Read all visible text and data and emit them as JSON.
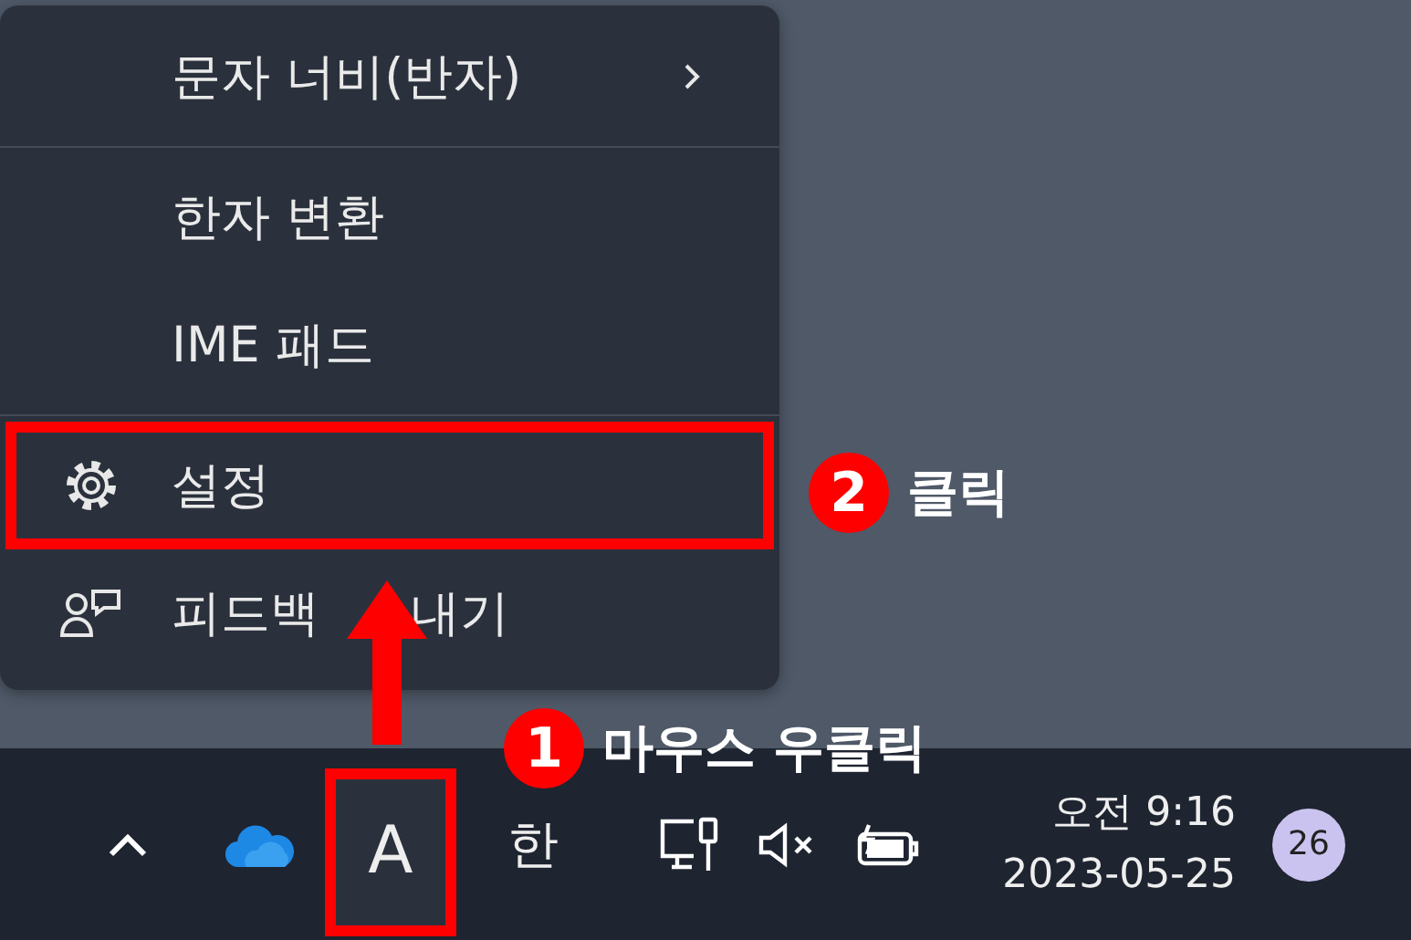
{
  "menu": {
    "items": [
      {
        "kind": "submenu",
        "label": "문자 너비(반자)",
        "highlighted": false,
        "separator_after": true
      },
      {
        "kind": "plain",
        "label": "한자 변환",
        "highlighted": false,
        "separator_after": false
      },
      {
        "kind": "plain",
        "label": "IME 패드",
        "highlighted": false,
        "separator_after": true
      },
      {
        "kind": "settings",
        "label": "설정",
        "highlighted": true,
        "separator_after": false
      },
      {
        "kind": "feedback",
        "label": "피드백",
        "label_tail": "내기",
        "highlighted": false,
        "separator_after": false
      }
    ]
  },
  "taskbar": {
    "input_mode": {
      "label": "A",
      "highlighted": true
    },
    "language": "한",
    "clock": {
      "time": "오전 9:16",
      "date": "2023-05-25"
    },
    "notification_count": "26"
  },
  "annotations": [
    {
      "number": "2",
      "text": "클릭"
    },
    {
      "number": "1",
      "text": "마우스 우클릭"
    }
  ]
}
